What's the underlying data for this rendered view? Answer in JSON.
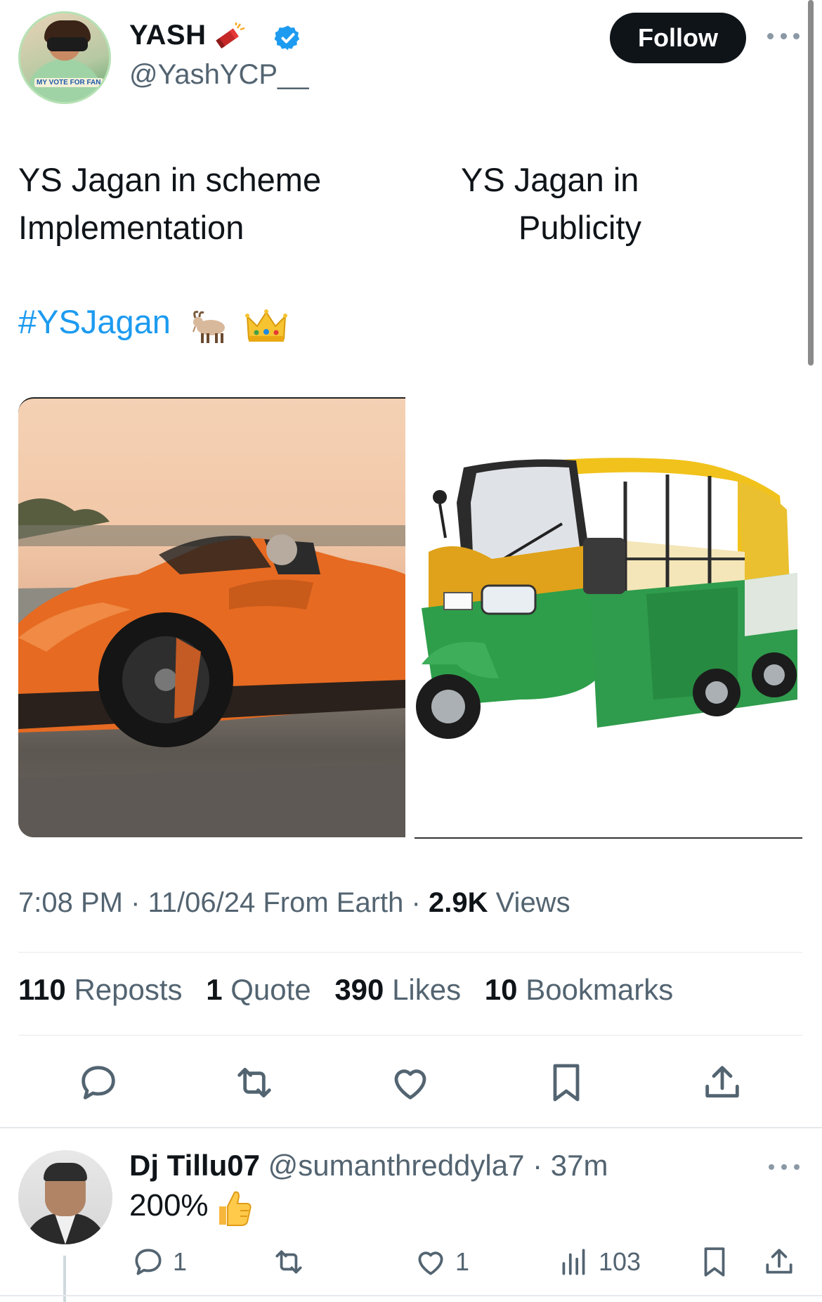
{
  "post": {
    "author_name": "YASH",
    "author_handle": "@YashYCP__",
    "follow_label": "Follow",
    "text_left_line1": "YS Jagan in scheme",
    "text_left_line2": "Implementation",
    "text_right_line1": "YS Jagan in",
    "text_right_line2": "Publicity",
    "hashtag": "#YSJagan",
    "emojis": [
      "goat-emoji",
      "crown-emoji",
      "firecracker-emoji"
    ],
    "images": [
      {
        "description_icon": "orange-sports-car-image"
      },
      {
        "description_icon": "auto-rickshaw-image"
      }
    ],
    "time": "7:08 PM",
    "date": "11/06/24",
    "source": "From Earth",
    "views_count": "2.9K",
    "views_label": "Views",
    "reposts_count": "110",
    "reposts_label": "Reposts",
    "quotes_count": "1",
    "quotes_label": "Quote",
    "likes_count": "390",
    "likes_label": "Likes",
    "bookmarks_count": "10",
    "bookmarks_label": "Bookmarks",
    "actions": [
      "reply-icon",
      "repost-icon",
      "like-icon",
      "bookmark-icon",
      "share-icon"
    ]
  },
  "reply": {
    "author_name": "Dj Tillu07",
    "author_handle": "@sumanthreddyla7",
    "time": "37m",
    "text": "200%",
    "reply_count": "1",
    "like_count": "1",
    "views_count": "103"
  },
  "colors": {
    "accent": "#1d9bf0",
    "text": "#0f1419",
    "secondary_text": "#536471",
    "divider": "#e6e9ec"
  }
}
